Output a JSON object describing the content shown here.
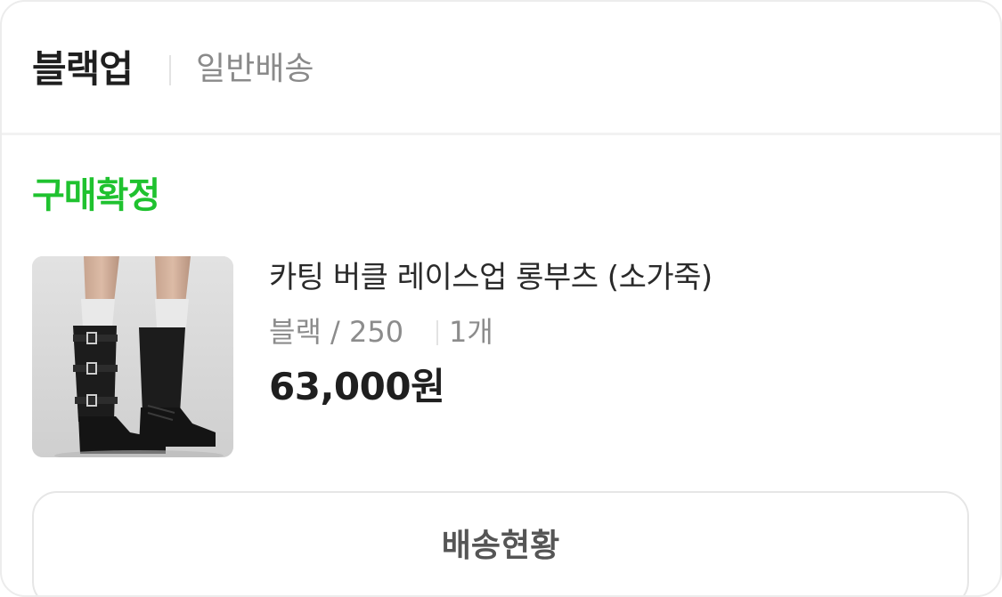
{
  "store": {
    "name": "블랙업",
    "shipping_type": "일반배송"
  },
  "order": {
    "status": "구매확정",
    "status_color": "#1fc22f"
  },
  "product": {
    "name": "카팅 버클 레이스업 롱부츠 (소가죽)",
    "option": "블랙 / 250",
    "quantity": "1개",
    "price": "63,000원",
    "thumbnail_icon": "black-long-boots-photo"
  },
  "actions": {
    "track_label": "배송현황"
  }
}
